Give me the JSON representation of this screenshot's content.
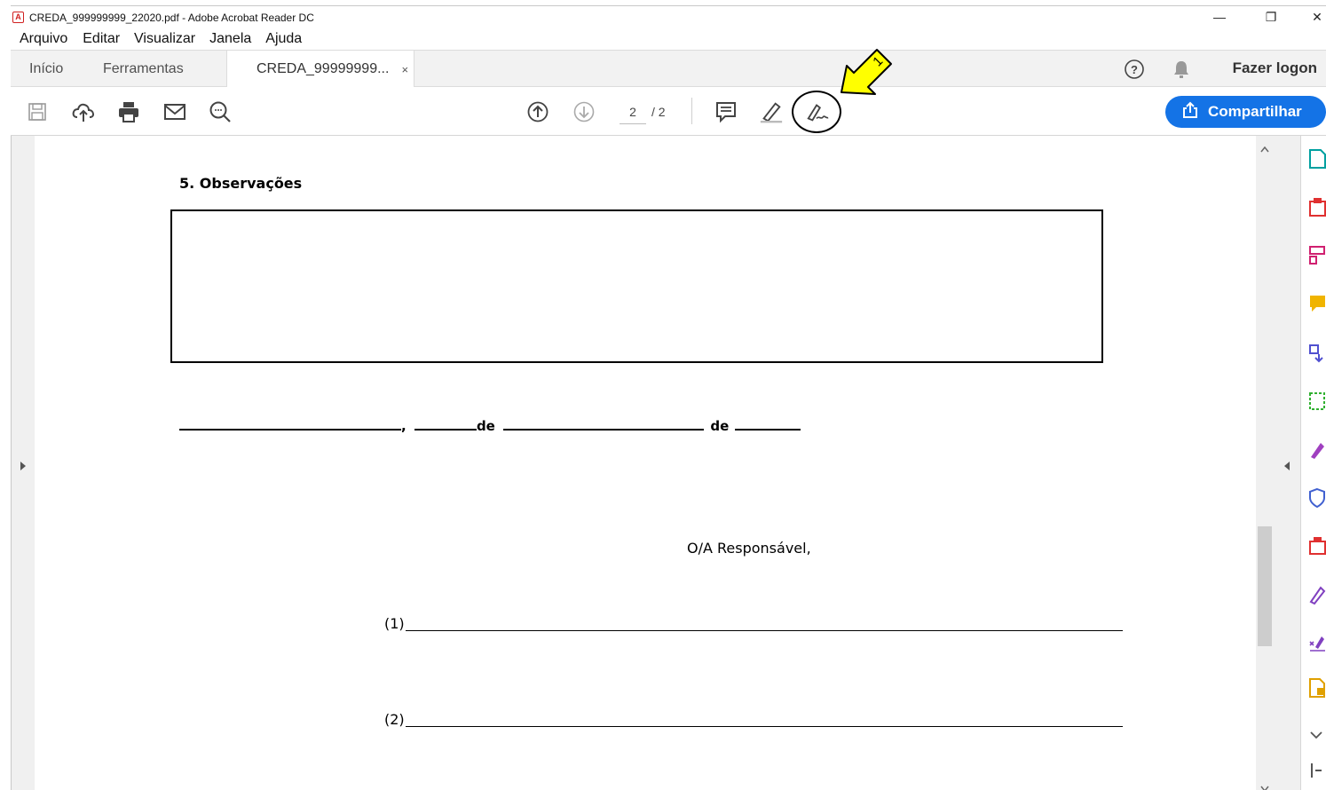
{
  "window": {
    "title": "CREDA_999999999_22020.pdf - Adobe Acrobat Reader DC",
    "app_icon": "pdf-icon",
    "controls": {
      "minimize": "—",
      "restore": "❐",
      "close": "✕"
    }
  },
  "menu": {
    "items": [
      "Arquivo",
      "Editar",
      "Visualizar",
      "Janela",
      "Ajuda"
    ]
  },
  "tabs": {
    "items": [
      {
        "label": "Início"
      },
      {
        "label": "Ferramentas"
      },
      {
        "label": "CREDA_99999999...",
        "close": "×"
      }
    ],
    "help_icon": "help-icon",
    "bell_icon": "bell-icon",
    "login_label": "Fazer logon"
  },
  "toolbar": {
    "current_page": "2",
    "total_pages": "/ 2",
    "share_label": "Compartilhar",
    "share_color": "#1473e6"
  },
  "document": {
    "section_title": "5. Observações",
    "date_line": {
      "comma": ",",
      "de1": "de",
      "de2": "de"
    },
    "responsible": "O/A Responsável,",
    "sig1": "(1)",
    "sig2": "(2)"
  },
  "annotation": {
    "marker": "1",
    "arrow_color": "#ffff00"
  }
}
